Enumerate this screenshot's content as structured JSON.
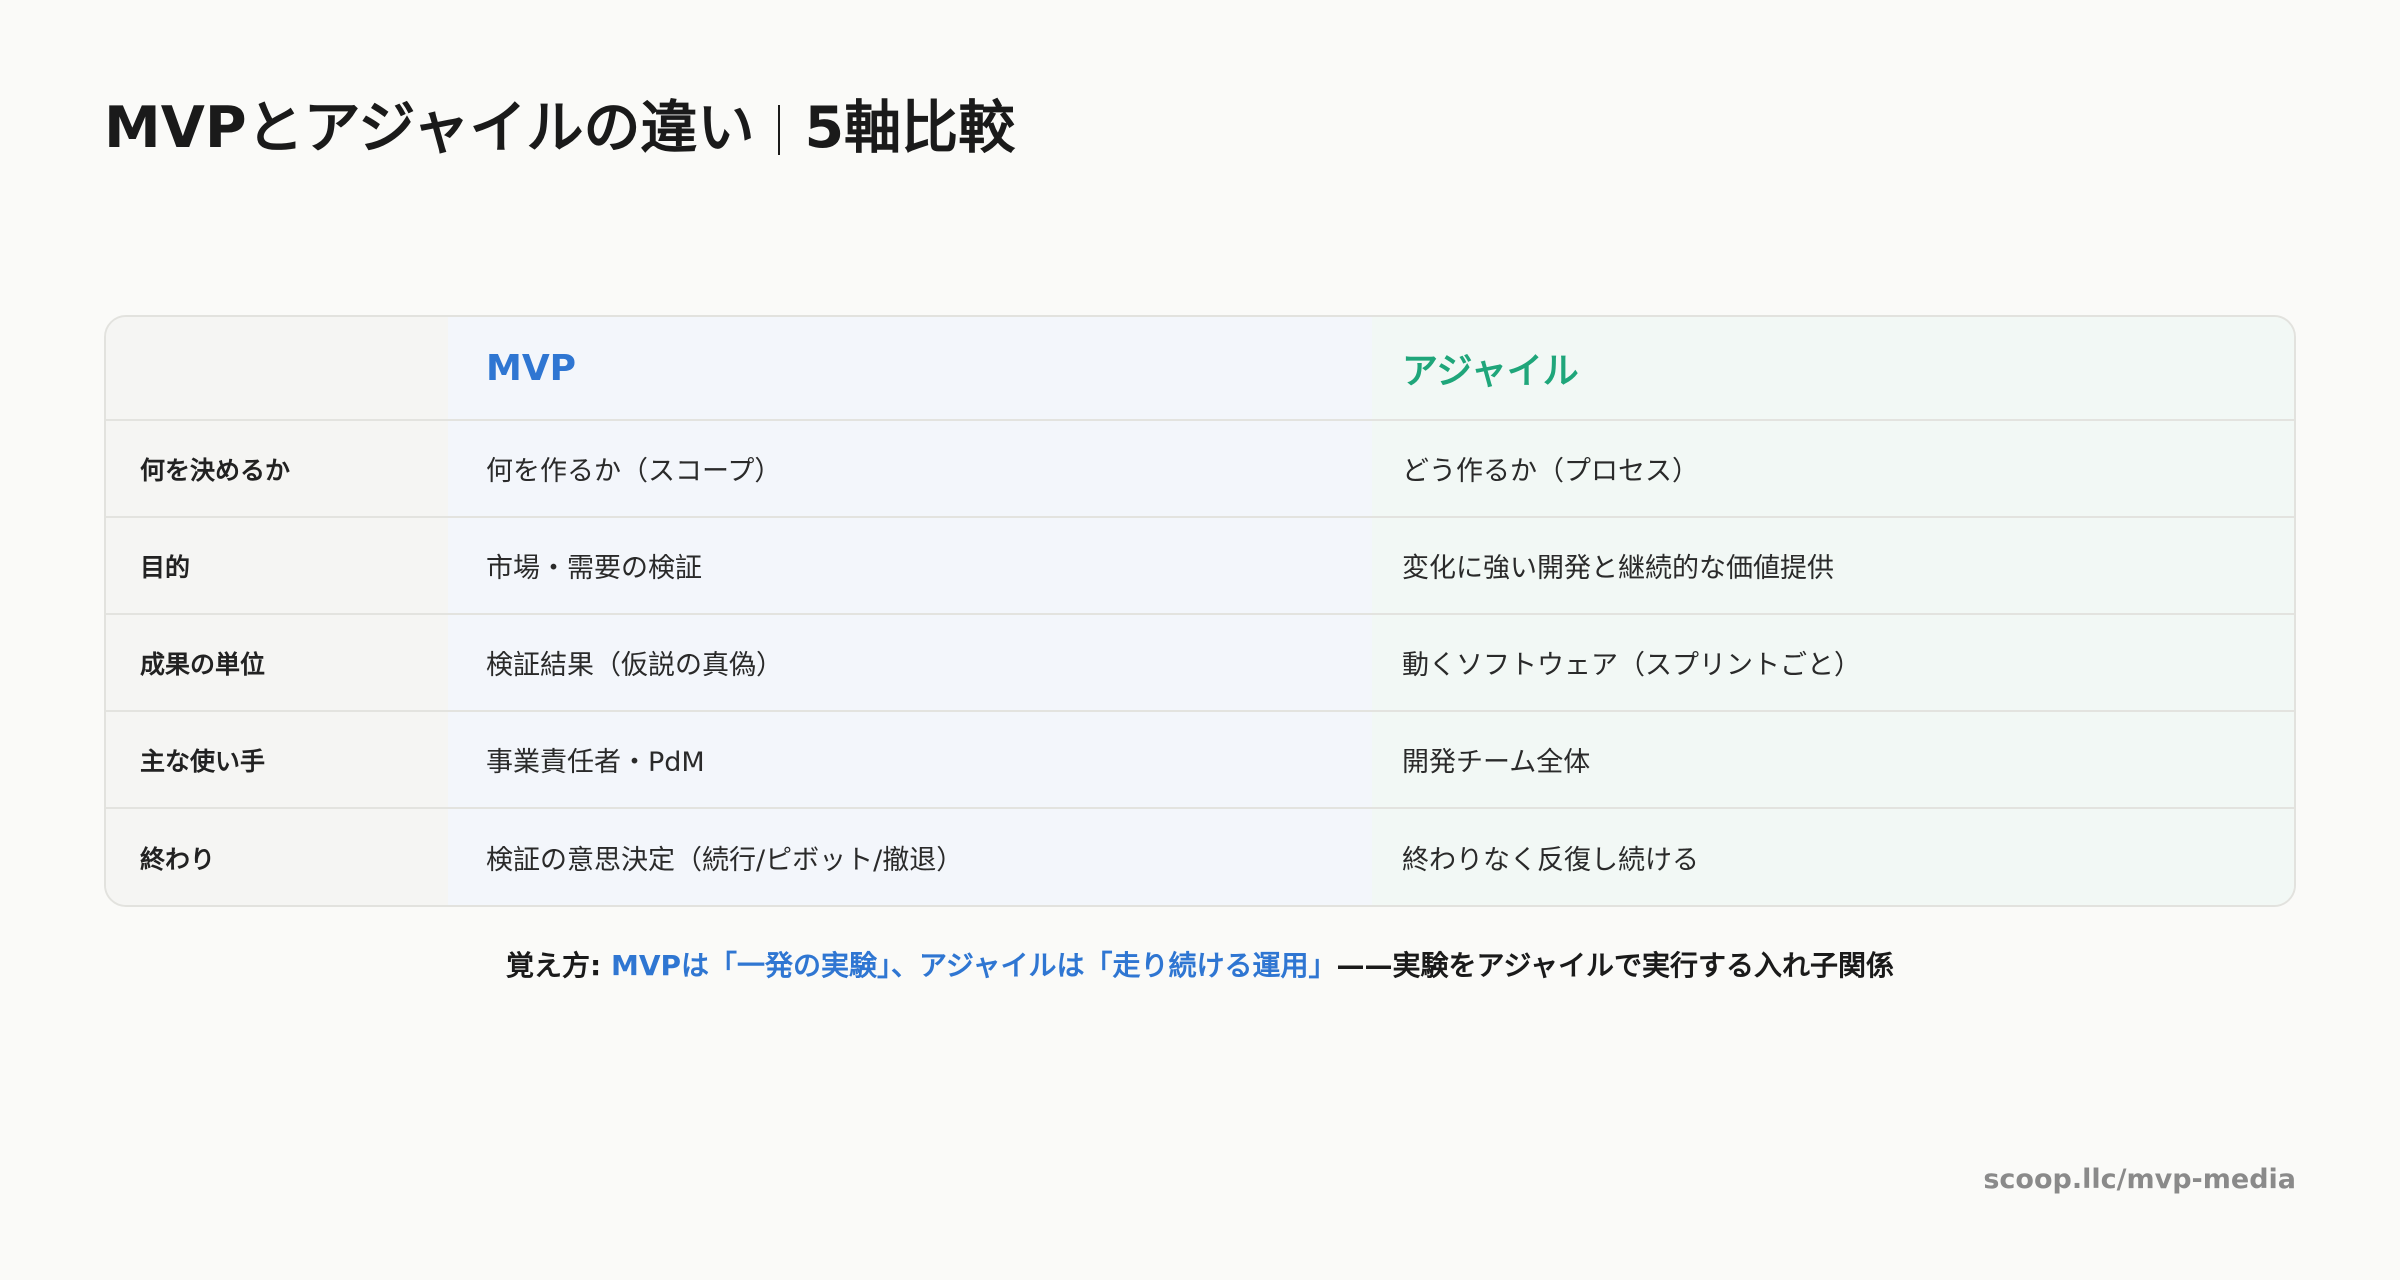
{
  "title": {
    "main": "MVPとアジャイルの違い",
    "sub": "5軸比較"
  },
  "table": {
    "headers": {
      "corner": "",
      "mvp": "MVP",
      "agile": "アジャイル"
    },
    "rows": [
      {
        "label": "何を決めるか",
        "mvp": "何を作るか（スコープ）",
        "agile": "どう作るか（プロセス）"
      },
      {
        "label": "目的",
        "mvp": "市場・需要の検証",
        "agile": "変化に強い開発と継続的な価値提供"
      },
      {
        "label": "成果の単位",
        "mvp": "検証結果（仮説の真偽）",
        "agile": "動くソフトウェア（スプリントごと）"
      },
      {
        "label": "主な使い手",
        "mvp": "事業責任者・PdM",
        "agile": "開発チーム全体"
      },
      {
        "label": "終わり",
        "mvp": "検証の意思決定（続行/ピボット/撤退）",
        "agile": "終わりなく反復し続ける"
      }
    ]
  },
  "note": {
    "lead": "覚え方: ",
    "highlight": "MVPは「一発の実験」、アジャイルは「走り続ける運用」",
    "tail": "——実験をアジャイルで実行する入れ子関係"
  },
  "footer": {
    "url": "scoop.llc/mvp-media"
  },
  "colors": {
    "mvp_accent": "#2f76d2",
    "agile_accent": "#1fa67a",
    "background": "#fafaf8"
  }
}
